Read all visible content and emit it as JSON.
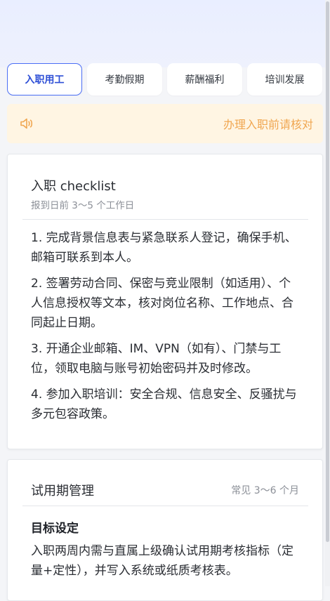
{
  "tabs": [
    {
      "label": "入职用工",
      "active": true
    },
    {
      "label": "考勤假期",
      "active": false
    },
    {
      "label": "薪酬福利",
      "active": false
    },
    {
      "label": "培训发展",
      "active": false
    }
  ],
  "notice": {
    "icon": "speaker-icon",
    "text": "办理入职前请核对"
  },
  "checklist_card": {
    "title": "入职 checklist",
    "subtitle": "报到日前 3～5 个工作日",
    "items": [
      "1. 完成背景信息表与紧急联系人登记，确保手机、邮箱可联系到本人。",
      "2. 签署劳动合同、保密与竞业限制（如适用）、个人信息授权等文本，核对岗位名称、工作地点、合同起止日期。",
      "3. 开通企业邮箱、IM、VPN（如有）、门禁与工位，领取电脑与账号初始密码并及时修改。",
      "4. 参加入职培训：安全合规、信息安全、反骚扰与多元包容政策。"
    ]
  },
  "probation_card": {
    "title": "试用期管理",
    "tag": "常见 3～6 个月",
    "section_heading": "目标设定",
    "section_body": "入职两周内需与直属上级确认试用期考核指标（定量+定性），并写入系统或纸质考核表。"
  },
  "colors": {
    "accent": "#4b6ef5",
    "notice_bg": "#fff5e3",
    "notice_text": "#f0a650"
  }
}
